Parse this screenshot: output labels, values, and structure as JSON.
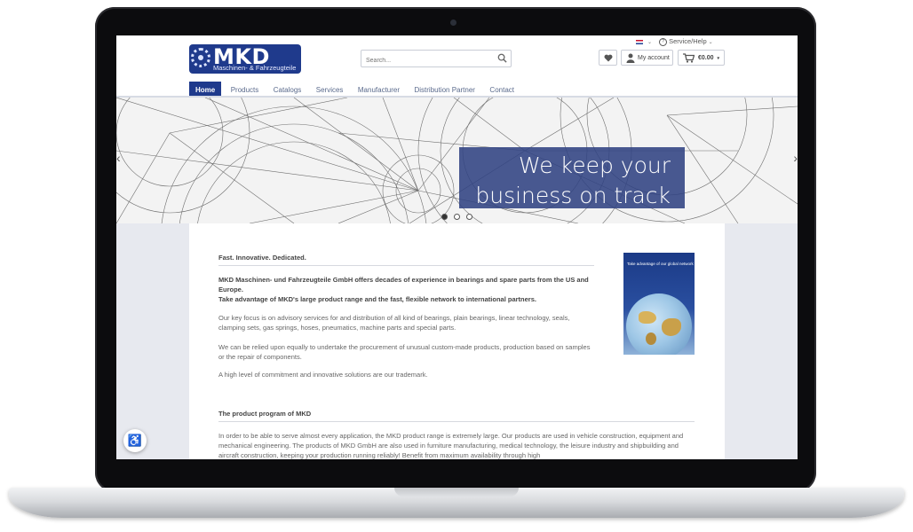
{
  "header": {
    "logo_text": "MKD",
    "logo_subtitle": "Maschinen- & Fahrzeugteile",
    "search_placeholder": "Search...",
    "service_help": "Service/Help",
    "my_account": "My account",
    "cart_total": "€0.00"
  },
  "nav": {
    "items": [
      "Home",
      "Products",
      "Catalogs",
      "Services",
      "Manufacturer",
      "Distribution Partner",
      "Contact"
    ],
    "active": "Home"
  },
  "hero": {
    "line1": "We keep your",
    "line2": "business on track",
    "slides": 3,
    "active_slide": 1
  },
  "content": {
    "tagline": "Fast. Innovative. Dedicated.",
    "intro_bold_1": "MKD Maschinen- und Fahrzeugteile GmbH offers decades of experience in bearings and spare parts from the US and Europe.",
    "intro_bold_2": "Take advantage of MKD's large product range and the fast, flexible network to international partners.",
    "para1": "Our key focus is on advisory services for and distribution of all kind of bearings, plain bearings, linear technology, seals, clamping sets, gas springs, hoses, pneumatics, machine parts and special parts.",
    "para2": "We can be relied upon equally to undertake the procurement of unusual custom-made products, production based on samples or the repair of components.",
    "para3": "A high level of commitment and innovative solutions are our trademark.",
    "section2_title": "The product program of MKD",
    "section2_text": "In order to be able to serve almost every application, the MKD product range is extremely large. Our products are used in vehicle construction, equipment and mechanical engineering. The products of MKD GmbH are also used in furniture manufacturing, medical technology, the leisure industry and shipbuilding and aircraft construction, keeping your production running reliably! Benefit from maximum availability through high",
    "brochure_title": "Take advantage of our global network"
  }
}
